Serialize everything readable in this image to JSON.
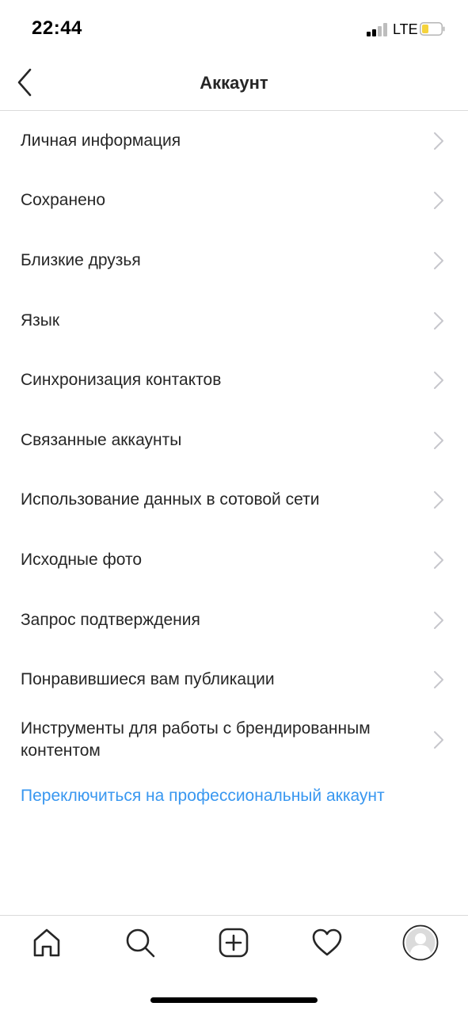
{
  "status_bar": {
    "time": "22:44",
    "network": "LTE",
    "battery_color": "#f5d33d"
  },
  "header": {
    "title": "Аккаунт",
    "back_icon": "chevron-left-icon"
  },
  "menu": {
    "items": [
      {
        "label": "Личная информация"
      },
      {
        "label": "Сохранено"
      },
      {
        "label": "Близкие друзья"
      },
      {
        "label": "Язык"
      },
      {
        "label": "Синхронизация контактов"
      },
      {
        "label": "Связанные аккаунты"
      },
      {
        "label": "Использование данных в сотовой сети"
      },
      {
        "label": "Исходные фото"
      },
      {
        "label": "Запрос подтверждения"
      },
      {
        "label": "Понравившиеся вам публикации"
      },
      {
        "label": "Инструменты для работы с брендированным контентом"
      }
    ],
    "chevron_icon": "chevron-right-icon"
  },
  "pro_link": {
    "label": "Переключиться на профессиональный аккаунт",
    "color": "#3897f0"
  },
  "tab_bar": {
    "tabs": [
      {
        "icon": "home-icon"
      },
      {
        "icon": "search-icon"
      },
      {
        "icon": "add-post-icon"
      },
      {
        "icon": "heart-icon"
      },
      {
        "icon": "profile-avatar-icon"
      }
    ]
  }
}
